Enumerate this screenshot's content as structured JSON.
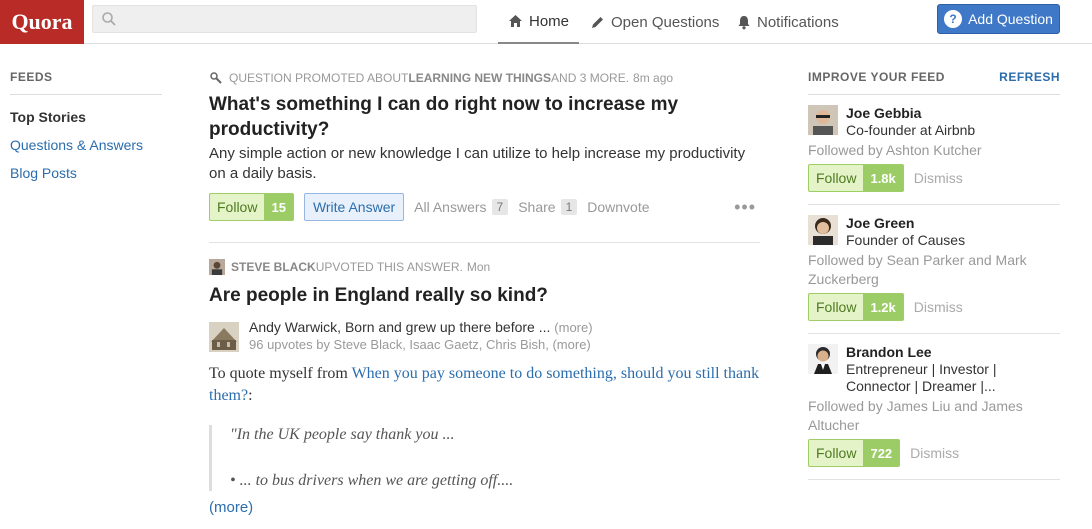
{
  "header": {
    "logo": "Quora",
    "search_placeholder": "",
    "nav": [
      {
        "label": "Home",
        "icon": "home-icon"
      },
      {
        "label": "Open Questions",
        "icon": "pencil-icon"
      },
      {
        "label": "Notifications",
        "icon": "bell-icon"
      }
    ],
    "add_question": "Add Question"
  },
  "left": {
    "heading": "FEEDS",
    "items": [
      "Top Stories",
      "Questions & Answers",
      "Blog Posts"
    ]
  },
  "feed": {
    "story1": {
      "meta_prefix": "QUESTION PROMOTED ABOUT ",
      "meta_topic": "LEARNING NEW THINGS",
      "meta_suffix": " AND 3 MORE.",
      "meta_time": "8m ago",
      "title": "What's something I can do right now to increase my productivity?",
      "detail": "Any simple action or new knowledge I can utilize to help increase my productivity on a daily basis.",
      "follow_label": "Follow",
      "follow_count": "15",
      "write_answer": "Write Answer",
      "all_answers": "All Answers",
      "all_answers_count": "7",
      "share": "Share",
      "share_count": "1",
      "downvote": "Downvote",
      "more": "•••"
    },
    "story2": {
      "meta_user": "STEVE BLACK",
      "meta_action": " UPVOTED THIS ANSWER.",
      "meta_time": "Mon",
      "title": "Are people in England really so kind?",
      "author": "Andy Warwick, Born and grew up there before ...",
      "author_more": "(more)",
      "votes": "96 upvotes by Steve Black, Isaac Gaetz, Chris Bish, (more)",
      "body_prefix": "To quote myself from ",
      "body_link": "When you pay someone to do something, should you still thank them?",
      "body_suffix": ":",
      "quote1": "\"In the UK people say thank you ...",
      "quote2": "... to bus drivers when we are getting off....",
      "more_link": "(more)"
    }
  },
  "right": {
    "heading": "IMPROVE YOUR FEED",
    "refresh": "REFRESH",
    "people": [
      {
        "name": "Joe Gebbia",
        "desc": "Co-founder at Airbnb",
        "followed": "Followed by Ashton Kutcher",
        "follow_label": "Follow",
        "count": "1.8k",
        "dismiss": "Dismiss"
      },
      {
        "name": "Joe Green",
        "desc": "Founder of Causes",
        "followed": "Followed by Sean Parker and Mark Zuckerberg",
        "follow_label": "Follow",
        "count": "1.2k",
        "dismiss": "Dismiss"
      },
      {
        "name": "Brandon Lee",
        "desc": "Entrepreneur | Investor | Connector | Dreamer |...",
        "followed": "Followed by James Liu and James Altucher",
        "follow_label": "Follow",
        "count": "722",
        "dismiss": "Dismiss"
      }
    ]
  },
  "colors": {
    "brand": "#b92b27",
    "accent": "#3e78c6",
    "link": "#2b6dad",
    "follow_green": "#9ccc65"
  }
}
